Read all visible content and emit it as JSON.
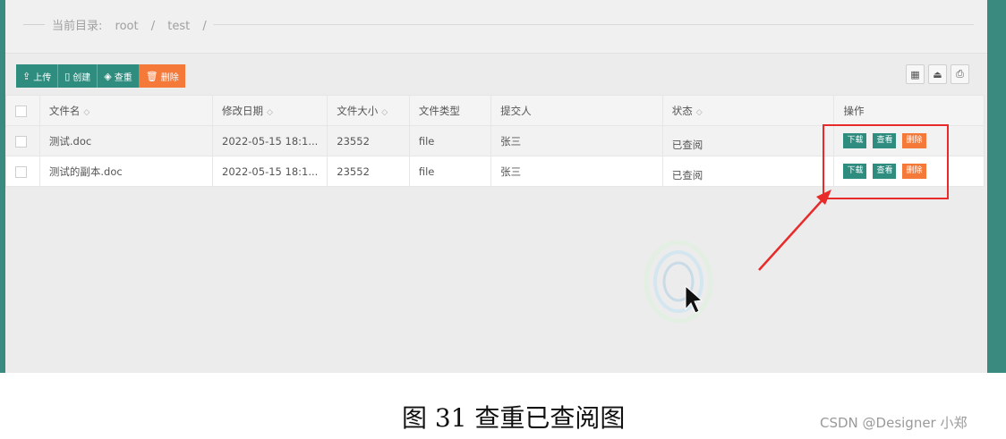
{
  "breadcrumb": {
    "label": "当前目录:",
    "parts": [
      "root",
      "/",
      "test",
      "/"
    ]
  },
  "toolbar": {
    "upload": "上传",
    "create": "创建",
    "dedup": "查重",
    "delete": "删除"
  },
  "table": {
    "headers": [
      "文件名",
      "修改日期",
      "文件大小",
      "文件类型",
      "提交人",
      "状态",
      "操作"
    ],
    "rows": [
      {
        "name": "测试.doc",
        "date": "2022-05-15 18:1...",
        "size": "23552",
        "type": "file",
        "submitter": "张三",
        "status": "已查阅"
      },
      {
        "name": "测试的副本.doc",
        "date": "2022-05-15 18:1...",
        "size": "23552",
        "type": "file",
        "submitter": "张三",
        "status": "已查阅"
      }
    ],
    "actions": {
      "download": "下载",
      "view": "查看",
      "delete": "删除"
    }
  },
  "caption": "图 31 查重已查阅图",
  "watermark": "CSDN @Designer 小郑",
  "colors": {
    "accent": "#2f8d80",
    "danger": "#f57a3a",
    "highlight": "#e82a2a"
  }
}
